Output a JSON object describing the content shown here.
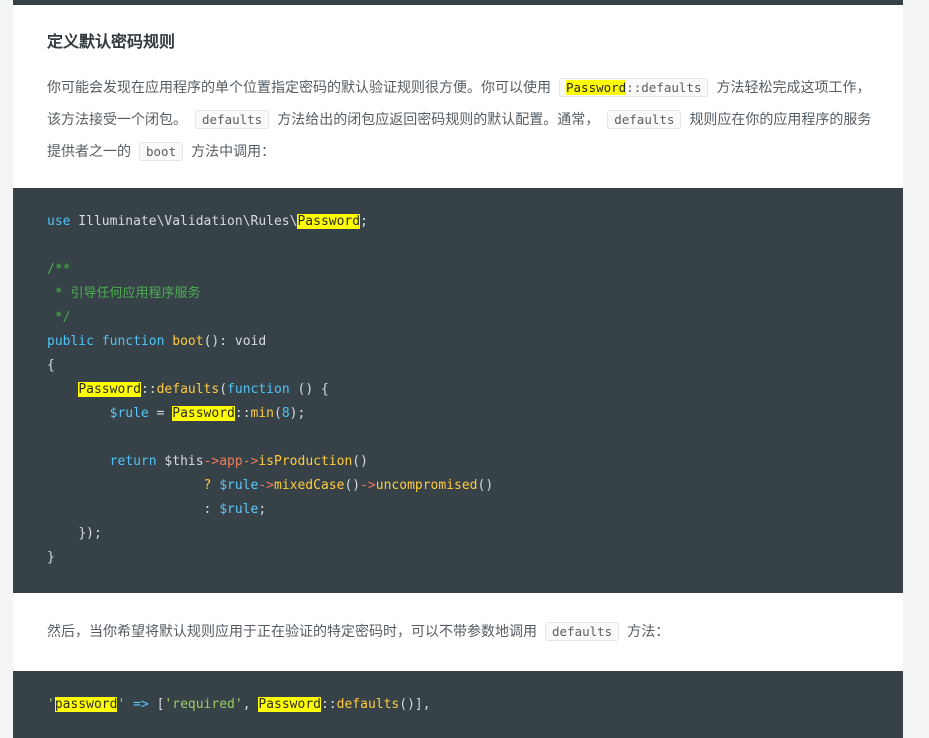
{
  "section": {
    "title": "定义默认密码规则"
  },
  "para1": {
    "t1": "你可能会发现在应用程序的单个位置指定密码的默认验证规则很方便。你可以使用",
    "code1_class": "Password",
    "code1_method": "::defaults",
    "t2": "方法轻松完成这项工作，该方法接受一个闭包。",
    "code2": "defaults",
    "t3": "方法给出的闭包应返回密码规则的默认配置。通常，",
    "code3": "defaults",
    "t4": "规则应在你的应用程序的服务提供者之一的",
    "code4": "boot",
    "t5": "方法中调用："
  },
  "code1": {
    "l1_use": "use",
    "l1_ns": " Illuminate\\Validation\\Rules\\",
    "l1_cls": "Password",
    "l1_end": ";",
    "l2": "/**",
    "l3": " * 引导任何应用程序服务",
    "l4": " */",
    "l5_public": "public",
    "l5_function": "function",
    "l5_boot": "boot",
    "l5_rest": "(): void",
    "l6": "{",
    "l7_cls": "Password",
    "l7_sep": "::",
    "l7_defaults": "defaults",
    "l7_open": "(",
    "l7_function": "function",
    "l7_rest": " () {",
    "l8_var": "$rule",
    "l8_eq": " = ",
    "l8_cls": "Password",
    "l8_sep": "::",
    "l8_min": "min",
    "l8_open": "(",
    "l8_num": "8",
    "l8_close": ");",
    "l9_return": "return",
    "l9_this": " $this",
    "l9_arrow1": "->",
    "l9_app": "app",
    "l9_arrow2": "->",
    "l9_isprod": "isProduction",
    "l9_paren": "()",
    "l10_q": "? ",
    "l10_var": "$rule",
    "l10_arrow1": "->",
    "l10_mixed": "mixedCase",
    "l10_paren1": "()",
    "l10_arrow2": "->",
    "l10_uncomp": "uncompromised",
    "l10_paren2": "()",
    "l11_colon": ": ",
    "l11_var": "$rule",
    "l11_end": ";",
    "l12": "});",
    "l13": "}"
  },
  "para2": {
    "t1": "然后，当你希望将默认规则应用于正在验证的特定密码时，可以不带参数地调用",
    "code": "defaults",
    "t2": "方法："
  },
  "code2": {
    "q1": "'",
    "key": "password",
    "q2": "'",
    "arrow": " => ",
    "bracket": "[",
    "req": "'required'",
    "comma": ", ",
    "cls": "Password",
    "sep": "::",
    "defaults": "defaults",
    "end": "()],"
  }
}
